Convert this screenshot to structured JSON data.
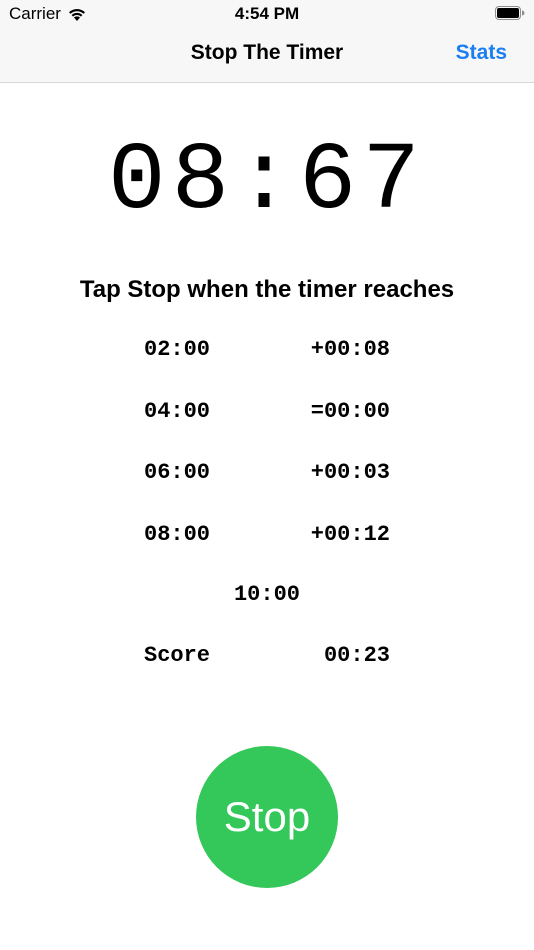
{
  "status_bar": {
    "carrier": "Carrier",
    "time": "4:54 PM"
  },
  "nav": {
    "title": "Stop The Timer",
    "stats_label": "Stats",
    "accent_color": "#1a7ff0"
  },
  "timer": {
    "display": "08:67"
  },
  "instructions": "Tap Stop when the timer reaches",
  "rounds": [
    {
      "target": "02:00",
      "diff": "+00:08"
    },
    {
      "target": "04:00",
      "diff": "=00:00"
    },
    {
      "target": "06:00",
      "diff": "+00:03"
    },
    {
      "target": "08:00",
      "diff": "+00:12"
    }
  ],
  "final_target": "10:00",
  "score": {
    "label": "Score",
    "value": "00:23"
  },
  "stop_button": {
    "label": "Stop",
    "color": "#34c759"
  }
}
